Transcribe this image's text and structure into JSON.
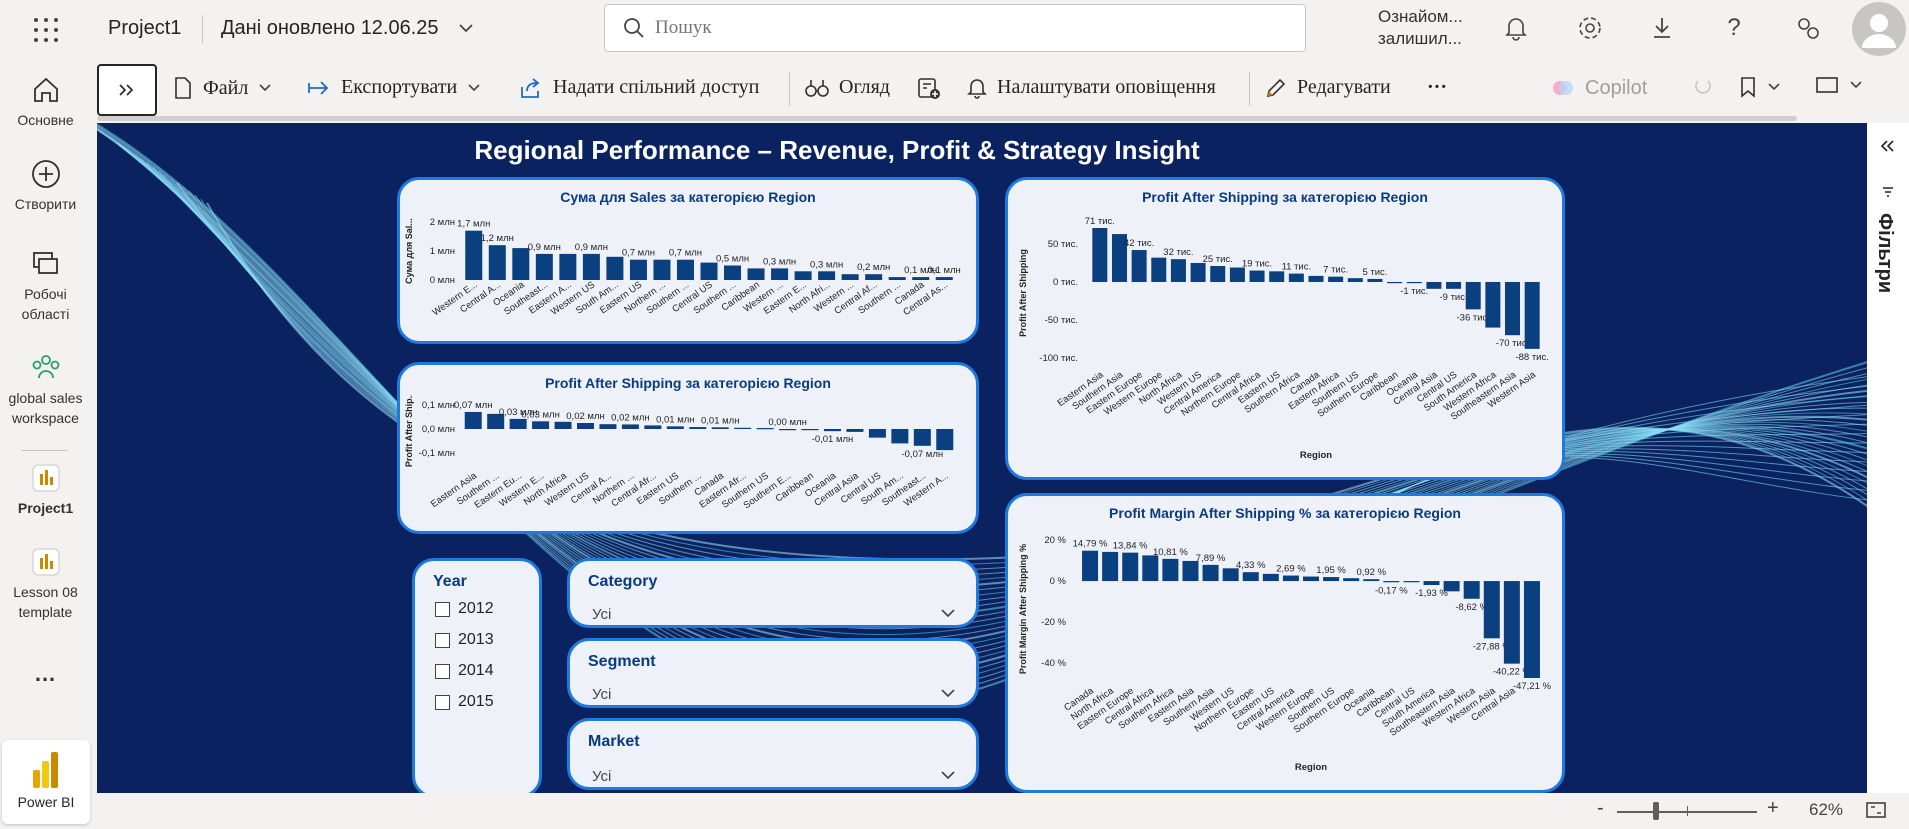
{
  "topbar": {
    "app_title": "Project1",
    "refresh_info": "Дані оновлено 12.06.25",
    "search_placeholder": "Пошук",
    "trial_line1": "Ознайом...",
    "trial_line2": "залишил..."
  },
  "rail": {
    "items": [
      {
        "label": "Основне",
        "icon": "home-icon"
      },
      {
        "label": "Створити",
        "icon": "plus-circle-icon"
      },
      {
        "label": "Робочі області",
        "icon": "workspaces-icon"
      },
      {
        "label": "global sales workspace",
        "icon": "people-group-icon"
      },
      {
        "label": "Project1",
        "icon": "report-icon"
      },
      {
        "label": "Lesson 08 template",
        "icon": "report-icon"
      }
    ],
    "more": "...",
    "powerbi_label": "Power BI"
  },
  "toolbar": {
    "file": "Файл",
    "export": "Експортувати",
    "share": "Надати спільний доступ",
    "view": "Огляд",
    "alerts": "Налаштувати оповіщення",
    "edit": "Редагувати",
    "more": "···",
    "copilot": "Copilot"
  },
  "filters_pane": {
    "label": "Фільтри"
  },
  "status": {
    "zoom": "62%",
    "minus": "-",
    "plus": "+"
  },
  "colors": {
    "canvas_bg": "#0a2260",
    "bar": "#0a3f80",
    "card_bg": "#eef1f8",
    "card_border": "#1f7ae0"
  },
  "report": {
    "title": "Regional Performance – Revenue, Profit & Strategy Insight",
    "slicers": {
      "year": {
        "title": "Year",
        "options": [
          "2012",
          "2013",
          "2014",
          "2015"
        ]
      },
      "category": {
        "title": "Category",
        "value": "Усі"
      },
      "segment": {
        "title": "Segment",
        "value": "Усі"
      },
      "market": {
        "title": "Market",
        "value": "Усі"
      }
    }
  },
  "chart_data": [
    {
      "id": "sales",
      "type": "bar",
      "title": "Сума для Sales за категорією Region",
      "ylabel": "Сума для Sal...",
      "yticks": [
        "2 млн",
        "1 млн",
        "0 млн"
      ],
      "ylim": [
        0,
        2
      ],
      "categories": [
        "Western E...",
        "Central A...",
        "Oceania",
        "Southeast...",
        "Eastern A...",
        "Western US",
        "South Am...",
        "Eastern US",
        "Northern ...",
        "Southern ...",
        "Central US",
        "Southern ...",
        "Caribbean",
        "Western ...",
        "Eastern E...",
        "North Afri...",
        "Western ...",
        "Central Af...",
        "Southern ...",
        "Canada",
        "Central As..."
      ],
      "values": [
        1.7,
        1.2,
        1.1,
        0.9,
        0.9,
        0.9,
        0.8,
        0.7,
        0.7,
        0.7,
        0.6,
        0.5,
        0.4,
        0.4,
        0.3,
        0.3,
        0.2,
        0.2,
        0.1,
        0.1,
        0.1
      ],
      "data_labels": [
        "1,7 млн",
        "1,2 млн",
        "",
        "0,9 млн",
        "",
        "0,9 млн",
        "",
        "0,7 млн",
        "",
        "0,7 млн",
        "",
        "0,5 млн",
        "",
        "0,3 млн",
        "",
        "0,3 млн",
        "",
        "0,2 млн",
        "",
        "0,1 млн",
        "0,1 млн"
      ]
    },
    {
      "id": "pas_small",
      "type": "bar",
      "title": "Profit After Shipping за категорією Region",
      "ylabel": "Profit After Ship...",
      "yticks": [
        "0,1 млн",
        "0,0 млн",
        "-0,1 млн"
      ],
      "ylim": [
        -0.1,
        0.1
      ],
      "categories": [
        "Eastern Asia",
        "Southern ...",
        "Eastern Eu...",
        "Western E...",
        "North Africa",
        "Western US",
        "Central A...",
        "Northern ...",
        "Central Afr...",
        "Eastern US",
        "Southern ...",
        "Canada",
        "Eastern Afr...",
        "Southern US",
        "Southern E...",
        "Caribbean",
        "Oceania",
        "Central Asia",
        "Central US",
        "South Am...",
        "Southeast...",
        "Western A..."
      ],
      "values": [
        0.071,
        0.063,
        0.042,
        0.032,
        0.03,
        0.025,
        0.02,
        0.019,
        0.015,
        0.011,
        0.008,
        0.007,
        0.005,
        0.004,
        0.0,
        -0.001,
        -0.009,
        -0.012,
        -0.036,
        -0.06,
        -0.07,
        -0.088
      ],
      "data_labels": [
        "0,07 млн",
        "",
        "0,03 млн",
        "0,03 млн",
        "",
        "0,02 млн",
        "",
        "0,02 млн",
        "",
        "0,01 млн",
        "",
        "0,01 млн",
        "",
        "",
        "0,00 млн",
        "",
        "-0,01 млн",
        "",
        "",
        "",
        "-0,07 млн",
        ""
      ]
    },
    {
      "id": "pas_big",
      "type": "bar",
      "title": "Profit After Shipping за категорією Region",
      "ylabel": "Profit After Shipping",
      "xlabel": "Region",
      "yticks": [
        "50 тис.",
        "0 тис.",
        "-50 тис.",
        "-100 тис."
      ],
      "ylim": [
        -100,
        71
      ],
      "categories": [
        "Eastern Asia",
        "Southern Asia",
        "Eastern Europe",
        "Western Europe",
        "North Africa",
        "Western US",
        "Central America",
        "Northern Europe",
        "Central Africa",
        "Eastern US",
        "Southern Africa",
        "Canada",
        "Eastern Africa",
        "Southern US",
        "Southern Europe",
        "Caribbean",
        "Oceania",
        "Central Asia",
        "Central US",
        "South America",
        "Western Africa",
        "Southeastern Asia",
        "Western Asia"
      ],
      "values": [
        71,
        63,
        42,
        32,
        30,
        25,
        21,
        19,
        15,
        14,
        11,
        8,
        7,
        5,
        4,
        0,
        -1,
        -9,
        -9,
        -36,
        -60,
        -70,
        -88
      ],
      "data_labels": [
        "71 тис.",
        "",
        "42 тис.",
        "",
        "32 тис.",
        "",
        "25 тис.",
        "",
        "19 тис.",
        "",
        "11 тис.",
        "",
        "7 тис.",
        "",
        "5 тис.",
        "",
        "-1 тис.",
        "",
        "-9 тис.",
        "-36 тис.",
        "",
        "-70 тис.",
        "-88 тис."
      ]
    },
    {
      "id": "margin",
      "type": "bar",
      "title": "Profit Margin After Shipping % за категорією Region",
      "ylabel": "Profit Margin After Shipping %",
      "xlabel": "Region",
      "yticks": [
        "20 %",
        "0 %",
        "-20 %",
        "-40 %"
      ],
      "ylim": [
        -47.21,
        20
      ],
      "categories": [
        "Canada",
        "North Africa",
        "Eastern Europe",
        "Central Africa",
        "Southern Africa",
        "Eastern Asia",
        "Southern Asia",
        "Western US",
        "Northern Europe",
        "Eastern US",
        "Central America",
        "Western Europe",
        "Southern US",
        "Southern Europe",
        "Oceania",
        "Caribbean",
        "Central US",
        "South America",
        "Southeastern Asia",
        "Western Africa",
        "Western Asia",
        "Central Asia"
      ],
      "values": [
        14.79,
        14.2,
        13.84,
        12.5,
        10.81,
        9.8,
        7.89,
        6.2,
        4.33,
        3.5,
        2.69,
        2.2,
        1.95,
        1.4,
        0.92,
        -0.17,
        -0.5,
        -1.93,
        -5.0,
        -8.62,
        -27.88,
        -40.22,
        -47.21
      ],
      "data_labels": [
        "14,79 %",
        "",
        "13,84 %",
        "",
        "10,81 %",
        "",
        "7,89 %",
        "",
        "4,33 %",
        "",
        "2,69 %",
        "",
        "1,95 %",
        "",
        "0,92 %",
        "-0,17 %",
        "",
        "-1,93 %",
        "",
        "-8,62 %",
        "-27,88 %",
        "-40,22 %",
        "-47,21 %"
      ]
    }
  ]
}
